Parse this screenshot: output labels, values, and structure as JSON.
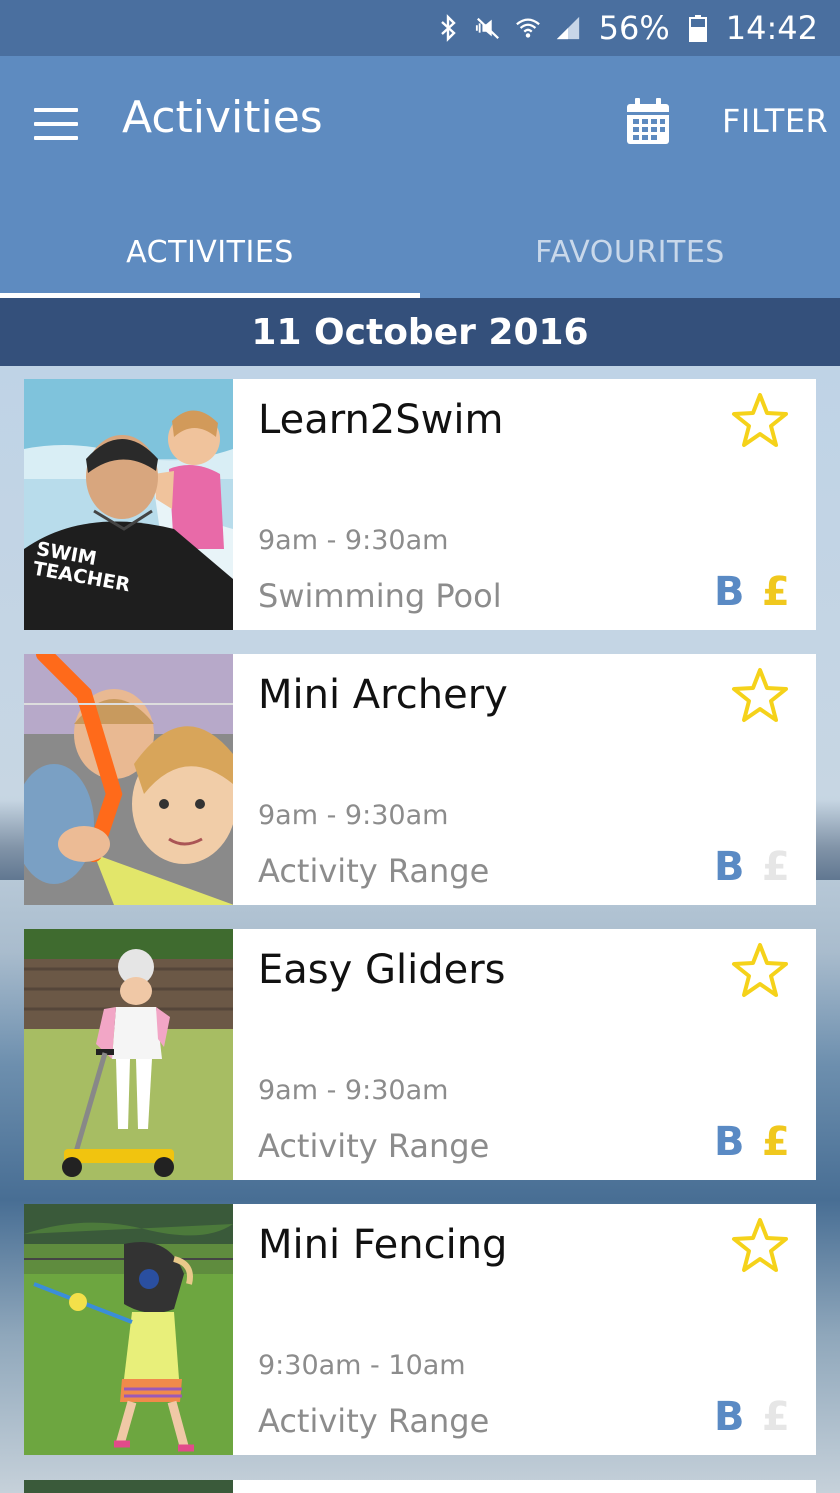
{
  "status_bar": {
    "battery": "56%",
    "time": "14:42",
    "icons": [
      "bluetooth-icon",
      "mute-icon",
      "wifi-icon",
      "signal-icon",
      "battery-icon"
    ]
  },
  "app_bar": {
    "title": "Activities",
    "calendar_icon": "calendar-icon",
    "filter_label": "FILTER"
  },
  "tabs": [
    {
      "label": "ACTIVITIES",
      "active": true
    },
    {
      "label": "FAVOURITES",
      "active": false
    }
  ],
  "date_header": "11 October 2016",
  "activities": [
    {
      "name": "Learn2Swim",
      "time": "9am - 9:30am",
      "location": "Swimming Pool",
      "badge_b": "B",
      "badge_price": "£",
      "price_active": true,
      "image_overlay": "SWIM\nTEACHER"
    },
    {
      "name": "Mini Archery",
      "time": "9am - 9:30am",
      "location": "Activity Range",
      "badge_b": "B",
      "badge_price": "£",
      "price_active": false
    },
    {
      "name": "Easy Gliders",
      "time": "9am - 9:30am",
      "location": "Activity Range",
      "badge_b": "B",
      "badge_price": "£",
      "price_active": true
    },
    {
      "name": "Mini Fencing",
      "time": "9:30am - 10am",
      "location": "Activity Range",
      "badge_b": "B",
      "badge_price": "£",
      "price_active": false
    }
  ],
  "colors": {
    "status_bar": "#4a6f9f",
    "app_bar": "#5e8bc0",
    "date_header": "#34507b",
    "star": "#f5d21a",
    "badge_b": "#5a8ac4",
    "price_on": "#f0c81e",
    "price_off": "#e6e6e6"
  }
}
